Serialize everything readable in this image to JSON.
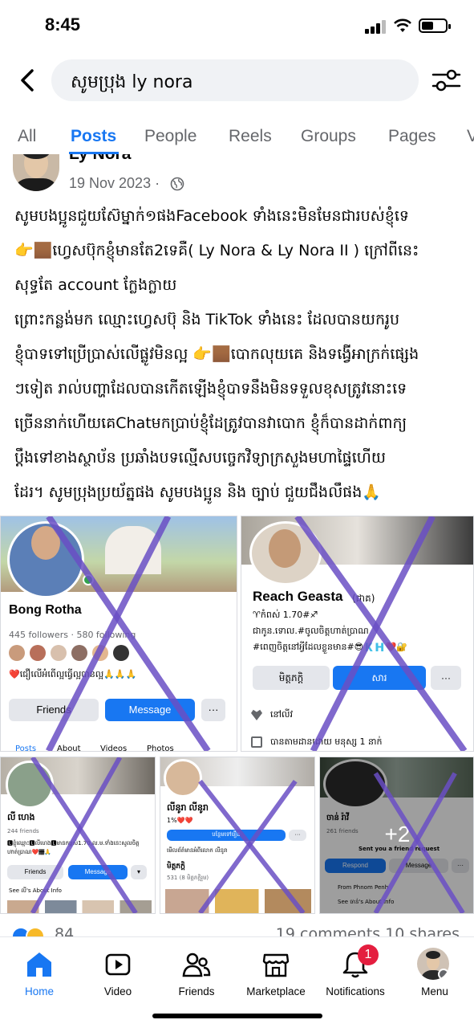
{
  "status_bar": {
    "time": "8:45"
  },
  "search": {
    "query": "សូមប្រុង ly nora"
  },
  "tabs": [
    {
      "label": "All"
    },
    {
      "label": "Posts"
    },
    {
      "label": "People"
    },
    {
      "label": "Reels"
    },
    {
      "label": "Groups"
    },
    {
      "label": "Pages"
    },
    {
      "label": "V"
    }
  ],
  "post": {
    "author": "Ly Nora",
    "date": "19 Nov 2023 ·",
    "lines": [
      "សូមបងប្អូនជួយស៊ែម្នាក់១ផងFacebook ទាំងនេះមិនមែនជារបស់ខ្ញុំទេ",
      "👉🏾ហ្វេសប៊ុកខ្ញុំមានតែ2ទេគឺ( Ly Nora & Ly Nora II ) ក្រៅពីនេះ",
      "សុទ្ធតែ account ក្លែងក្លាយ",
      "ព្រោះកន្លង់មក ឈ្មោះហ្វេសប៊ុ និង TikTok ទាំងនេះ ដែលបានយករូប",
      "ខ្ញុំបាទទៅប្រើប្រាស់លើផ្លូវមិនល្អ 👉🏾បោកលុយគេ និងទង្វើអាក្រក់ផ្សេង",
      "ៗទៀត រាល់បញ្ហាដែលបានកើតឡើងខ្ញុំបាទនឹងមិនទទួលខុសត្រូវនោះទេ",
      "ច្រើននាក់ហើយគេChatមកប្រាប់ខ្ញុំដែត្រូវបានវាបោក ខ្ញុំក៏បានដាក់ពាក្យ",
      "ប្ដឹងទៅខាងស្ថាប័ន ប្រឆាំងបទល្មើសបច្ចេកវិទ្យាក្រសួងមហាផ្ទៃហើយ",
      "ដែរ។ សូមប្រុងប្រយ័ត្នផង សូមបងប្អូន និង ច្បាប់ ជួយជឹងលឹផង🙏"
    ],
    "reactions_count": "84",
    "comments_shares": "19 comments  10 shares"
  },
  "screenshots": {
    "s1": {
      "name": "Bong Rotha",
      "followers": "445 followers · 580 following",
      "bio": "❤️ជឿលើអំពើល្អធ្វើល្អបានល្អ🙏🙏🙏",
      "friends_btn": "Friends",
      "message_btn": "Message",
      "more_btn": "···",
      "tabs": [
        "Posts",
        "About",
        "Videos",
        "Photos"
      ]
    },
    "s2": {
      "name": "Reach Geasta",
      "name_suffix": "(ជាគ)",
      "line1": "♈កំពស់ 1.70#♐",
      "line2": "ជាកូន.ទោល.#ចូលចិត្តហាត់ប្រាណ",
      "line3": "#ពេញចិត្តនៅអ្វីដែលខ្លួនមាន#😎🇰🇭❤️🔐",
      "friends_btn": "មិត្តភក្តិ",
      "message_btn": "សារ",
      "more_btn": "···",
      "row1": "នៅលីវ",
      "row2": "បានតាមដានដោយ មនុស្ស 1 នាក់"
    },
    "s3": {
      "name": "លី ហេង",
      "friends": "244 friends",
      "bio1": "🅻ខ្ញុំឈ្មោះ🅻លីហេង🅻មានកម្ពស់1.70,ល.ម.ទាំងនេះសូលចិត្ត",
      "bio2": "ហាត់ប្រាណ❤️🏾🙏",
      "friends_btn": "Friends",
      "message_btn": "Message",
      "see_about": "See លី's About Info"
    },
    "s4": {
      "name": "លីនូរា លីនូរា",
      "hearts": "1%❤️❤️",
      "add_btn": "បន្ថែមទៅរឿង",
      "view_info": "មើលព័ត៌មានអំពីលោក លីនូរា",
      "friends_label": "មិត្តភក្តិ",
      "friends_count": "531 (8 មិត្តភក្តិរួម)"
    },
    "s5": {
      "name": "ចាន់ រ៉ាវី",
      "friends": "261 friends",
      "sent": "Sent you a friend request",
      "respond_btn": "Respond",
      "message_btn": "Message",
      "from": "From Phnom Penh",
      "see_about": "See ចាន់'s About Info",
      "overlay": "+2"
    }
  },
  "bottom_nav": [
    {
      "label": "Home",
      "icon": "home-icon"
    },
    {
      "label": "Video",
      "icon": "video-icon"
    },
    {
      "label": "Friends",
      "icon": "friends-icon"
    },
    {
      "label": "Marketplace",
      "icon": "marketplace-icon"
    },
    {
      "label": "Notifications",
      "icon": "bell-icon"
    },
    {
      "label": "Menu",
      "icon": "menu-avatar"
    }
  ],
  "notifications_badge": "1",
  "colors": {
    "accent": "#1877f2",
    "cross": "#6a4fc4",
    "badge": "#e41e3f"
  }
}
